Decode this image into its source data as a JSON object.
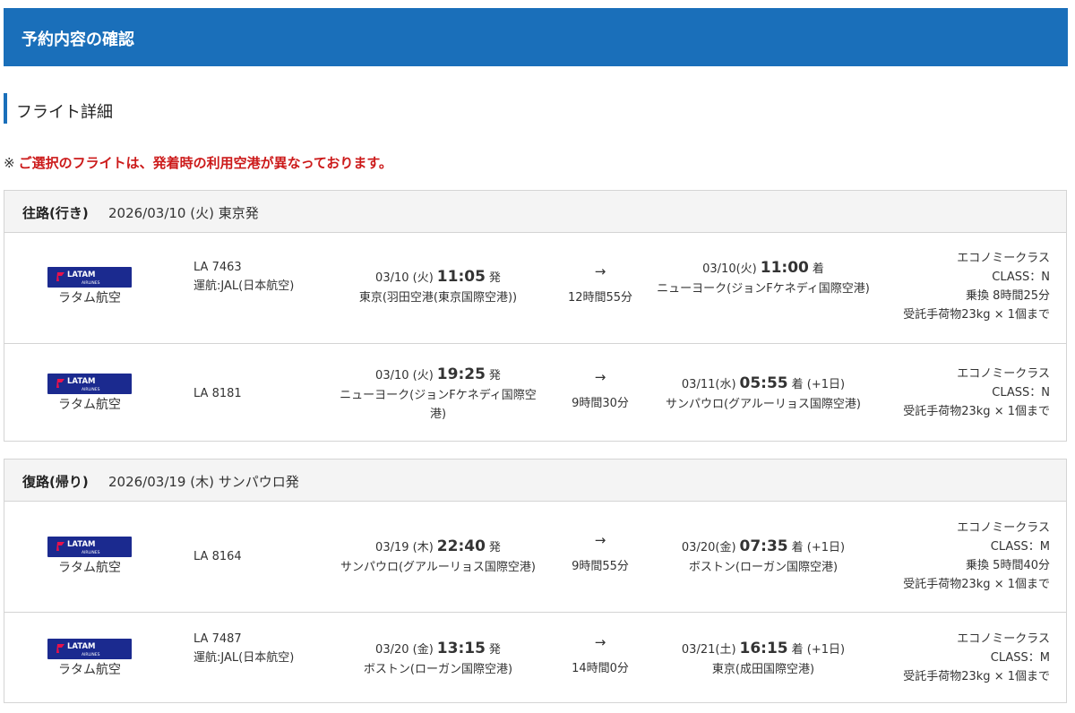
{
  "header": {
    "title": "予約内容の確認"
  },
  "section": {
    "title": "フライト詳細"
  },
  "warning": {
    "mark": "※",
    "text": "ご選択のフライトは、発着時の利用空港が異なっております。"
  },
  "brand_color": "#1a6fba",
  "warning_color": "#cc1a1a",
  "logo": {
    "brand": "LATAM",
    "sub": "AIRLINES"
  },
  "outbound": {
    "direction": "往路(行き)",
    "date": "2026/03/10 (火) 東京発",
    "segments": [
      {
        "airline": "ラタム航空",
        "flight_no": "LA 7463",
        "operated_by": "運航:JAL(日本航空)",
        "dep_date": "03/10 (火)",
        "dep_time": "11:05",
        "dep_suffix": "発",
        "dep_airport": "東京(羽田空港(東京国際空港))",
        "arrow": "→",
        "duration": "12時間55分",
        "arr_date": "03/10(火)",
        "arr_time": "11:00",
        "arr_suffix": "着",
        "arr_airport": "ニューヨーク(ジョンFケネディ国際空港)",
        "cabin": "エコノミークラス",
        "class": "CLASS：N",
        "transfer": "乗換 8時間25分",
        "baggage": "受託手荷物23kg × 1個まで"
      },
      {
        "airline": "ラタム航空",
        "flight_no": "LA 8181",
        "operated_by": "",
        "dep_date": "03/10 (火)",
        "dep_time": "19:25",
        "dep_suffix": "発",
        "dep_airport": "ニューヨーク(ジョンFケネディ国際空港)",
        "arrow": "→",
        "duration": "9時間30分",
        "arr_date": "03/11(水)",
        "arr_time": "05:55",
        "arr_suffix": "着 (+1日)",
        "arr_airport": "サンパウロ(グアルーリョス国際空港)",
        "cabin": "エコノミークラス",
        "class": "CLASS：N",
        "transfer": "",
        "baggage": "受託手荷物23kg × 1個まで"
      }
    ]
  },
  "return": {
    "direction": "復路(帰り)",
    "date": "2026/03/19 (木) サンパウロ発",
    "segments": [
      {
        "airline": "ラタム航空",
        "flight_no": "LA 8164",
        "operated_by": "",
        "dep_date": "03/19 (木)",
        "dep_time": "22:40",
        "dep_suffix": "発",
        "dep_airport": "サンパウロ(グアルーリョス国際空港)",
        "arrow": "→",
        "duration": "9時間55分",
        "arr_date": "03/20(金)",
        "arr_time": "07:35",
        "arr_suffix": "着 (+1日)",
        "arr_airport": "ボストン(ローガン国際空港)",
        "cabin": "エコノミークラス",
        "class": "CLASS：M",
        "transfer": "乗換 5時間40分",
        "baggage": "受託手荷物23kg × 1個まで"
      },
      {
        "airline": "ラタム航空",
        "flight_no": "LA 7487",
        "operated_by": "運航:JAL(日本航空)",
        "dep_date": "03/20 (金)",
        "dep_time": "13:15",
        "dep_suffix": "発",
        "dep_airport": "ボストン(ローガン国際空港)",
        "arrow": "→",
        "duration": "14時間0分",
        "arr_date": "03/21(土)",
        "arr_time": "16:15",
        "arr_suffix": "着 (+1日)",
        "arr_airport": "東京(成田国際空港)",
        "cabin": "エコノミークラス",
        "class": "CLASS：M",
        "transfer": "",
        "baggage": "受託手荷物23kg × 1個まで"
      }
    ]
  }
}
